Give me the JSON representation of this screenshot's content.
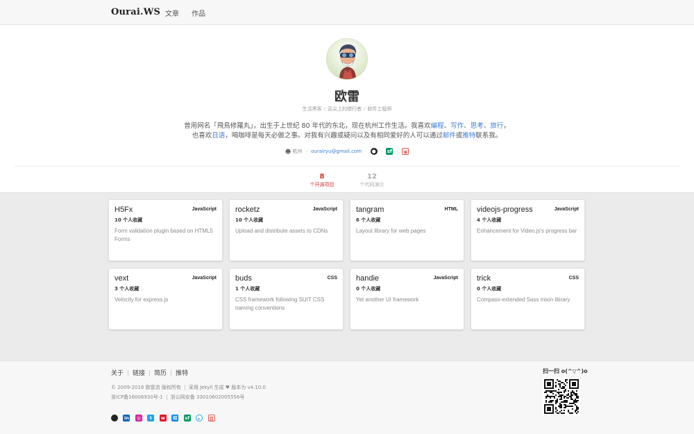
{
  "nav": {
    "brand": "Ourai.WS",
    "links": [
      "文章",
      "作品"
    ]
  },
  "profile": {
    "name": "欧雷",
    "tags": [
      "生活黑客",
      "舌尖上的猎行者",
      "软件工程师"
    ],
    "bio_line1": {
      "prefix": "曾用网名「飛鳥修羅丸」，出生于上世纪 80 年代的东北，现在杭州工作生活。我喜欢",
      "links": [
        "编程",
        "写作",
        "思考",
        "旅行"
      ],
      "suffix": "，"
    },
    "bio_line2": {
      "prefix": "也喜欢",
      "link1": "日语",
      "middle": "，喝咖啡是每天必做之事。对我有兴趣或疑问以及有相同爱好的人可以通过",
      "link2": "邮件",
      "or": "或",
      "link3": "推特",
      "suffix": "联系我。"
    },
    "location": "杭州",
    "email": "ourairyu@gmail.com",
    "contact_icons": [
      "github-icon",
      "segmentfault-icon",
      "weibo-icon"
    ]
  },
  "stats": [
    {
      "num": "8",
      "label": "个开源项目"
    },
    {
      "num": "12",
      "label": "个代码演示"
    }
  ],
  "projects": [
    {
      "name": "H5Fx",
      "lang": "JavaScript",
      "stars": "10 个人收藏",
      "desc": "Form validation plugin based on HTML5 Forms"
    },
    {
      "name": "rocketz",
      "lang": "JavaScript",
      "stars": "10 个人收藏",
      "desc": "Upload and distribute assets to CDNs"
    },
    {
      "name": "tangram",
      "lang": "HTML",
      "stars": "6 个人收藏",
      "desc": "Layout library for web pages"
    },
    {
      "name": "videojs-progress",
      "lang": "JavaScript",
      "stars": "4 个人收藏",
      "desc": "Enhancement for Video.js's progress bar"
    },
    {
      "name": "vext",
      "lang": "JavaScript",
      "stars": "3 个人收藏",
      "desc": "Velocity for express.js"
    },
    {
      "name": "buds",
      "lang": "CSS",
      "stars": "1 个人收藏",
      "desc": "CSS framework following SUIT CSS naming conventions"
    },
    {
      "name": "handie",
      "lang": "JavaScript",
      "stars": "0 个人收藏",
      "desc": "Yet another UI framework"
    },
    {
      "name": "trick",
      "lang": "CSS",
      "stars": "0 个人收藏",
      "desc": "Compass-extended Sass mixin library"
    }
  ],
  "footer": {
    "links": [
      "关于",
      "链接",
      "简历",
      "推特"
    ],
    "copyright": "© 2009-2018 欧雷流 版权所有",
    "powered": "采用 Jekyll 生成 ♥ 版本为 v4.10.0",
    "icp": "浙ICP备16006930号-1",
    "police": "浙公网安备 33010602005556号",
    "social_icons": [
      "github-icon",
      "linkedin-icon",
      "instagram-icon",
      "twitter-icon",
      "weibo-icon",
      "zhihu-icon",
      "segmentfault-icon",
      "youku-icon",
      "douban-icon"
    ],
    "social_glyphs": [
      "",
      "in",
      "◎",
      "t",
      "w",
      "知",
      "sf",
      "▸",
      "豆"
    ],
    "qr_title": "扫一扫 o(^▽^)o"
  },
  "colors": {
    "accent_link": "#3a7bd5",
    "active_stat": "#d0312d",
    "page_bg": "#ebebeb"
  }
}
